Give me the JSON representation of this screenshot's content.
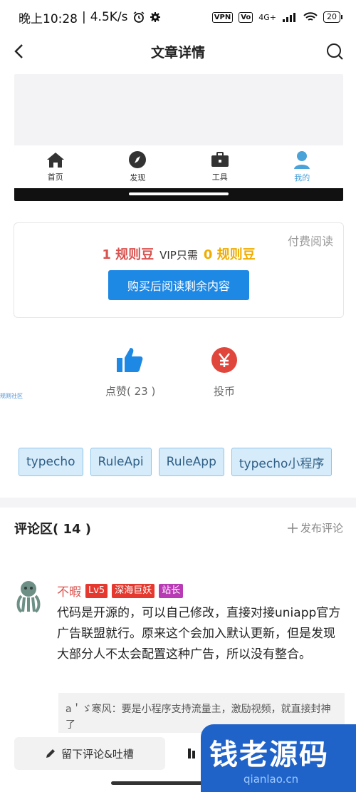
{
  "status_bar": {
    "time": "晚上10:28",
    "speed": "4.5K/s",
    "vpn": "VPN",
    "network": "4G+",
    "battery": "20"
  },
  "nav": {
    "title": "文章详情"
  },
  "embed": {
    "tabs": [
      {
        "label": "首页",
        "icon": "home-icon"
      },
      {
        "label": "发现",
        "icon": "compass-icon"
      },
      {
        "label": "工具",
        "icon": "toolbox-icon"
      },
      {
        "label": "我的",
        "icon": "user-icon"
      }
    ]
  },
  "paid": {
    "tag": "付费阅读",
    "price": "1 规则豆",
    "vip_label": "VIP只需",
    "vip_price": "0 规则豆",
    "buy_button": "购买后阅读剩余内容"
  },
  "actions": {
    "like": "点赞( 23 )",
    "coin": "投币",
    "side_note": "规则社区"
  },
  "tags": [
    "typecho",
    "RuleApi",
    "RuleApp",
    "typecho小程序"
  ],
  "comments": {
    "title": "评论区( 14 )",
    "post_label": "发布评论",
    "item": {
      "name": "不暇",
      "level": "Lv5",
      "title_badge": "深海巨妖",
      "admin_badge": "站长",
      "text": "代码是开源的，可以自己修改，直接对接uniapp官方广告联盟就行。原来这个会加入默认更新，但是发现大部分人不太会配置这种广告，所以没有整合。",
      "reply": "a＇ゞ寒风：要是小程序支持流量主，激励视频，就直接封神了"
    }
  },
  "bottom": {
    "leave_comment": "留下评论&吐槽"
  },
  "watermark": {
    "brand": "钱老源码",
    "url": "qianlao.cn"
  },
  "colors": {
    "accent": "#1e88e5",
    "price_red": "#d9534f",
    "vip_gold": "#f0ad00",
    "tag_bg": "#d7ecfb"
  }
}
